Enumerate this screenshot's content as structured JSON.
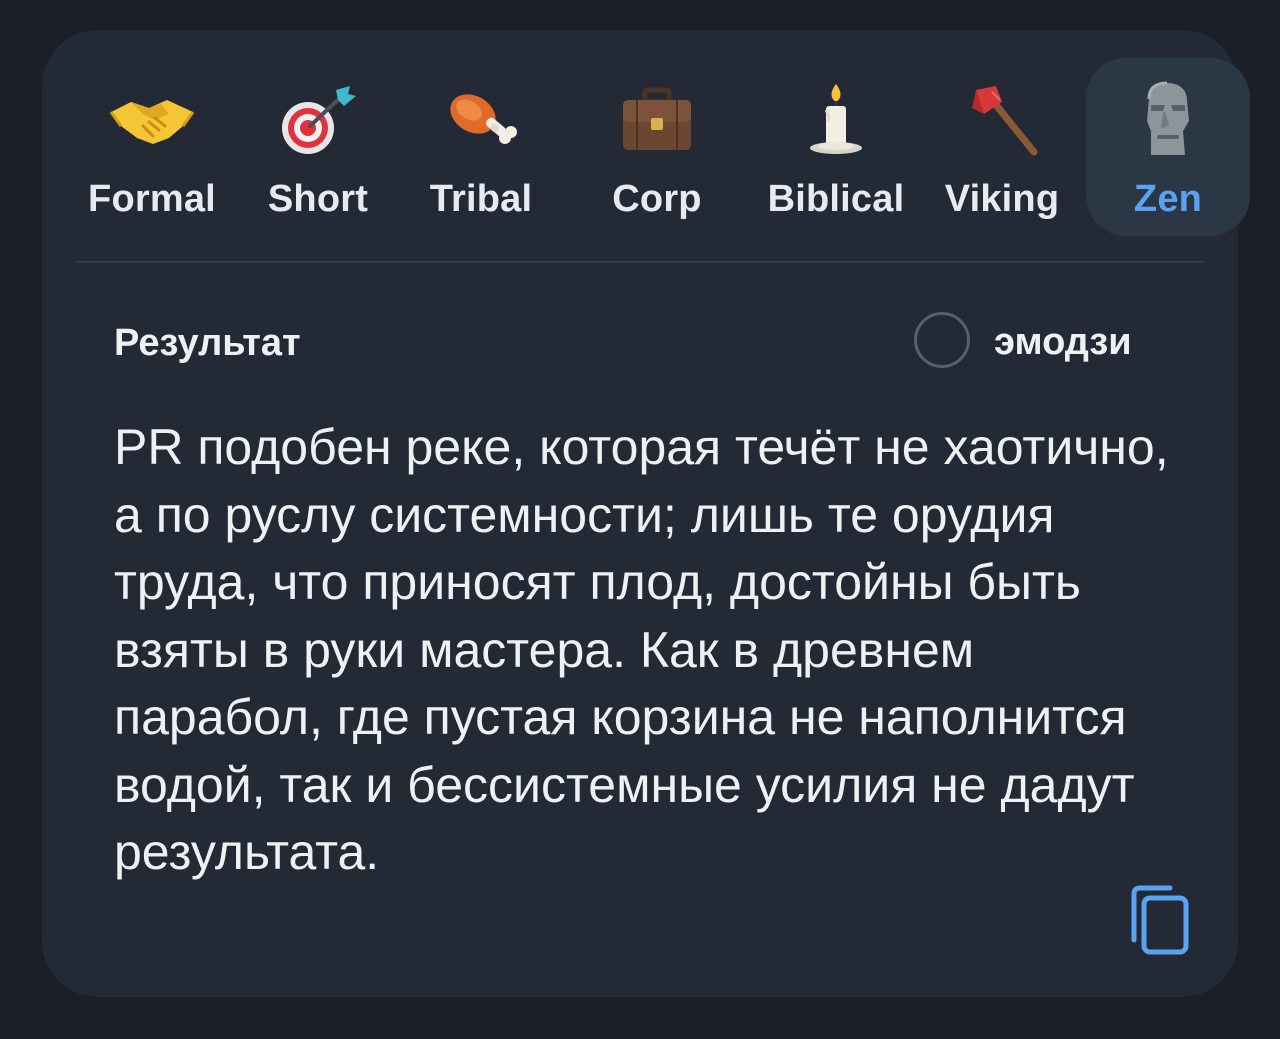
{
  "tones": [
    {
      "label": "Formal",
      "icon": "handshake-icon",
      "selected": false
    },
    {
      "label": "Short",
      "icon": "target-icon",
      "selected": false
    },
    {
      "label": "Tribal",
      "icon": "meat-on-bone-icon",
      "selected": false
    },
    {
      "label": "Corp",
      "icon": "briefcase-icon",
      "selected": false
    },
    {
      "label": "Biblical",
      "icon": "candle-icon",
      "selected": false
    },
    {
      "label": "Viking",
      "icon": "axe-icon",
      "selected": false
    },
    {
      "label": "Zen",
      "icon": "moai-icon",
      "selected": true
    }
  ],
  "result": {
    "title": "Результат",
    "emoji_toggle_label": "эмодзи",
    "emoji_toggle_checked": false,
    "text": "PR подобен реке, которая течёт не хаотично, а по руслу системности; лишь те орудия труда, что приносят плод, достойны быть взяты в руки мастера. Как в древнем парабол, где пустая корзина не наполнится водой, так и бессистемные усилия не дадут результата."
  },
  "colors": {
    "background": "#1b1f27",
    "card": "#232a35",
    "selected_bg": "#2c3746",
    "accent": "#5aa2f2",
    "text": "#eef0f4"
  }
}
